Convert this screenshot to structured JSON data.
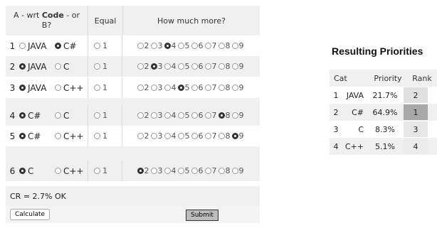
{
  "header": {
    "a_line1": "A - wrt ",
    "a_bold": "Code",
    "a_line1_end": " - or",
    "a_line2": "B?",
    "equal": "Equal",
    "how_much": "How much more?"
  },
  "scale": [
    "2",
    "3",
    "4",
    "5",
    "6",
    "7",
    "8",
    "9"
  ],
  "rows": [
    {
      "num": "1",
      "a": "JAVA",
      "b": "C#",
      "eq": "1",
      "a_sel": false,
      "b_sel": true,
      "intensity": "4"
    },
    {
      "num": "2",
      "a": "JAVA",
      "b": "C",
      "eq": "1",
      "a_sel": true,
      "b_sel": false,
      "intensity": "3"
    },
    {
      "num": "3",
      "a": "JAVA",
      "b": "C++",
      "eq": "1",
      "a_sel": true,
      "b_sel": false,
      "intensity": "5"
    },
    {
      "num": "4",
      "a": "C#",
      "b": "C",
      "eq": "1",
      "a_sel": true,
      "b_sel": false,
      "intensity": "8"
    },
    {
      "num": "5",
      "a": "C#",
      "b": "C++",
      "eq": "1",
      "a_sel": true,
      "b_sel": false,
      "intensity": "9"
    },
    {
      "num": "6",
      "a": "C",
      "b": "C++",
      "eq": "1",
      "a_sel": true,
      "b_sel": false,
      "intensity": "2"
    }
  ],
  "cr_text": "CR = 2.7% OK",
  "buttons": {
    "calculate": "Calculate",
    "submit": "Submit"
  },
  "results": {
    "title": "Resulting Priorities",
    "headers": {
      "cat": "Cat",
      "priority": "Priority",
      "rank": "Rank"
    },
    "rows": [
      {
        "num": "1",
        "cat": "JAVA",
        "priority": "21.7%",
        "rank": "2",
        "rank_color": "#e0e0e0"
      },
      {
        "num": "2",
        "cat": "C#",
        "priority": "64.9%",
        "rank": "1",
        "rank_color": "#a8a8a8"
      },
      {
        "num": "3",
        "cat": "C",
        "priority": "8.3%",
        "rank": "3",
        "rank_color": "#e6e6e6"
      },
      {
        "num": "4",
        "cat": "C++",
        "priority": "5.1%",
        "rank": "4",
        "rank_color": "#ececec"
      }
    ]
  }
}
